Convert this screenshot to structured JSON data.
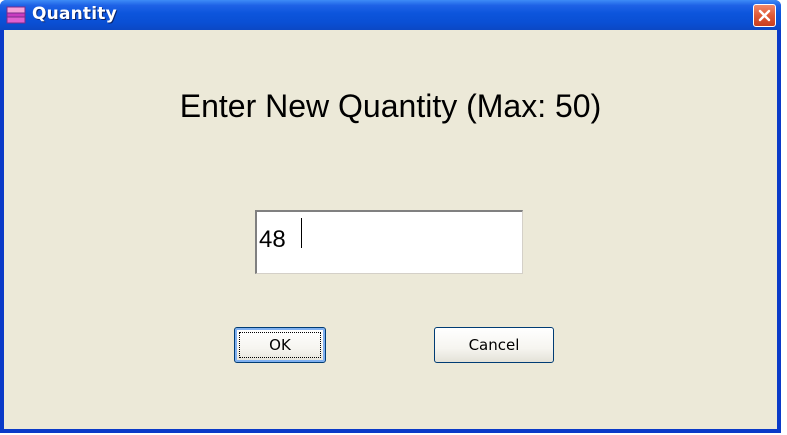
{
  "window": {
    "title": "Quantity",
    "icon": "app-window-icon",
    "close_icon": "close-icon"
  },
  "dialog": {
    "prompt": "Enter New Quantity (Max: 50)",
    "quantity_value": "48",
    "ok_label": "OK",
    "cancel_label": "Cancel"
  },
  "colors": {
    "titlebar": "#0a4fd4",
    "client_background": "#ece9d8",
    "close_button": "#e05a36"
  }
}
